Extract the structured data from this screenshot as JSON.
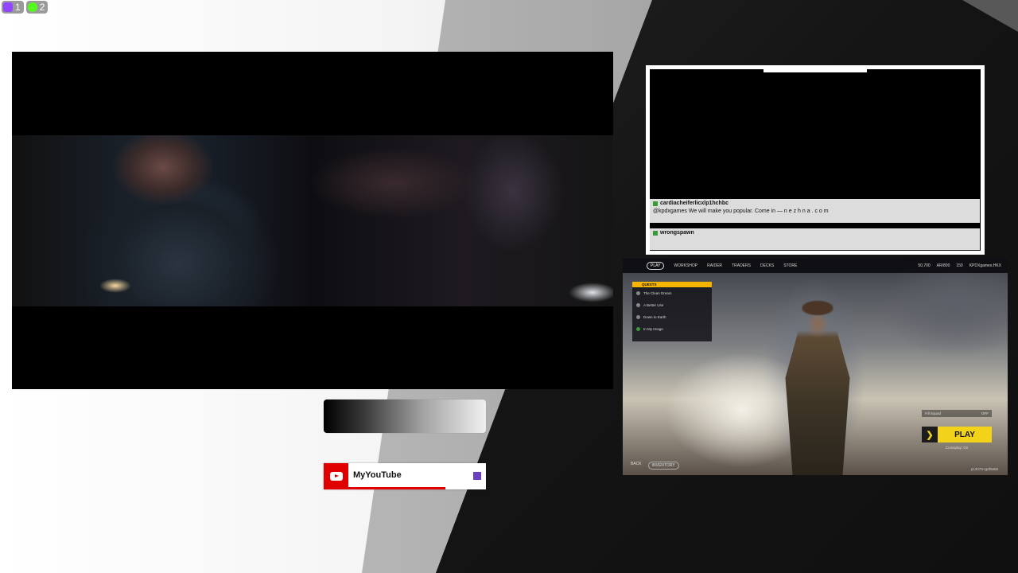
{
  "counters": [
    {
      "platform": "twitch-icon",
      "count": "1"
    },
    {
      "platform": "kick-icon",
      "count": "2"
    }
  ],
  "chat": {
    "messages": [
      {
        "user": "cardiacheiferlicxlp1hchbc",
        "text": "@kpdxgames We will make you popular. Come in — n e z h n a . c o m"
      },
      {
        "user": "wrongspawn",
        "text": ""
      }
    ]
  },
  "game": {
    "tabs": [
      "PLAY",
      "WORKSHOP",
      "RAIDER",
      "TRADERS",
      "DECKS",
      "STORE"
    ],
    "currency": [
      "50,700",
      "AR/800",
      "150"
    ],
    "player": "KPDXgames.HKX",
    "quests_title": "QUESTS",
    "quests": [
      "The Clean Dream",
      "A Better Use",
      "Down to Earth",
      "In My Image"
    ],
    "fill_squad_label": "Fill Squad",
    "fill_squad_value": "OFF",
    "play_label": "PLAY",
    "crossplay": "Crossplay: On",
    "bottom": [
      "BACK",
      "INVENTORY"
    ],
    "build": "p13079-rg6f9a58"
  },
  "youtube": {
    "label": "MyYouTube",
    "accent": "#e00000"
  }
}
